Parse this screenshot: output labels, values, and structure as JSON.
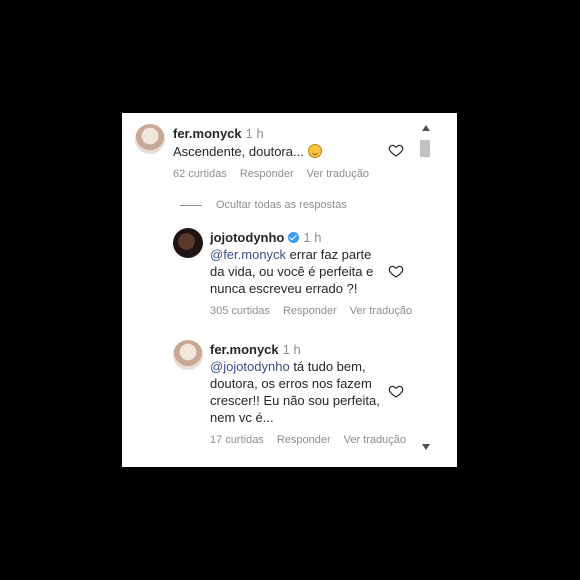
{
  "comments": [
    {
      "username": "fer.monyck",
      "time": "1 h",
      "text": "Ascendente, doutora...",
      "emoji": "upside-down-face-emoji",
      "likes": "62 curtidas",
      "reply": "Responder",
      "translate": "Ver tradução"
    }
  ],
  "hide_replies": "Ocultar todas as respostas",
  "replies": [
    {
      "username": "jojotodynho",
      "verified": true,
      "time": "1 h",
      "mention": "@fer.monyck",
      "text_parts": [
        " errar faz parte",
        "da vida, ou você é perfeita e",
        "nunca escreveu errado ?!"
      ],
      "likes": "305 curtidas",
      "reply": "Responder",
      "translate": "Ver tradução"
    },
    {
      "username": "fer.monyck",
      "time": "1 h",
      "mention": "@jojotodynho",
      "text_parts": [
        " tá tudo bem,",
        "doutora, os erros nos fazem",
        "crescer!! Eu não sou perfeita,",
        "nem vc é..."
      ],
      "likes": "17 curtidas",
      "reply": "Responder",
      "translate": "Ver tradução"
    }
  ],
  "colors": {
    "background": "#000000",
    "panel": "#ffffff",
    "text": "#262626",
    "muted": "#8e8e8e",
    "mention": "#385185",
    "verified": "#3897f0"
  }
}
